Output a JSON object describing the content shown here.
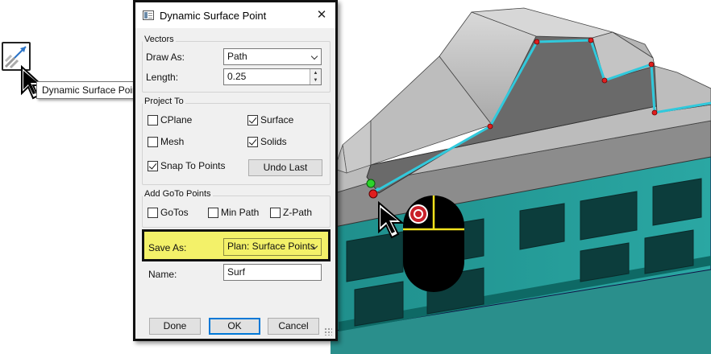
{
  "tooltip": {
    "text": "Dynamic Surface Point"
  },
  "tool": {
    "icon": "dynamic-surface-point-icon"
  },
  "dialog": {
    "title": "Dynamic Surface Point",
    "close_symbol": "✕",
    "vectors": {
      "heading": "Vectors",
      "draw_as_label": "Draw As:",
      "draw_as_value": "Path",
      "length_label": "Length:",
      "length_value": "0.25"
    },
    "project_to": {
      "heading": "Project To",
      "cplane": "CPlane",
      "surface": "Surface",
      "mesh": "Mesh",
      "solids": "Solids",
      "snap_to_points": "Snap To Points",
      "undo_last": "Undo Last",
      "checked": {
        "cplane": false,
        "surface": true,
        "mesh": false,
        "solids": true,
        "snap_to_points": true
      }
    },
    "goto": {
      "heading": "Add GoTo Points",
      "gotos": "GoTos",
      "min_path": "Min Path",
      "z_path": "Z-Path",
      "checked": {
        "gotos": false,
        "min_path": false,
        "z_path": false
      }
    },
    "save_as_label": "Save As:",
    "save_as_value": "Plan: Surface Points",
    "name_label": "Name:",
    "name_value": "Surf",
    "buttons": {
      "done": "Done",
      "ok": "OK",
      "cancel": "Cancel"
    }
  },
  "colors": {
    "highlight": "#f3f169",
    "path_line": "#31c9dc",
    "point_red": "#e01e1e",
    "point_green": "#2bd42b",
    "frame_teal": "#1d8f8a",
    "part_gray": "#6d6d6d",
    "mouse_accent": "#f2e21d"
  }
}
